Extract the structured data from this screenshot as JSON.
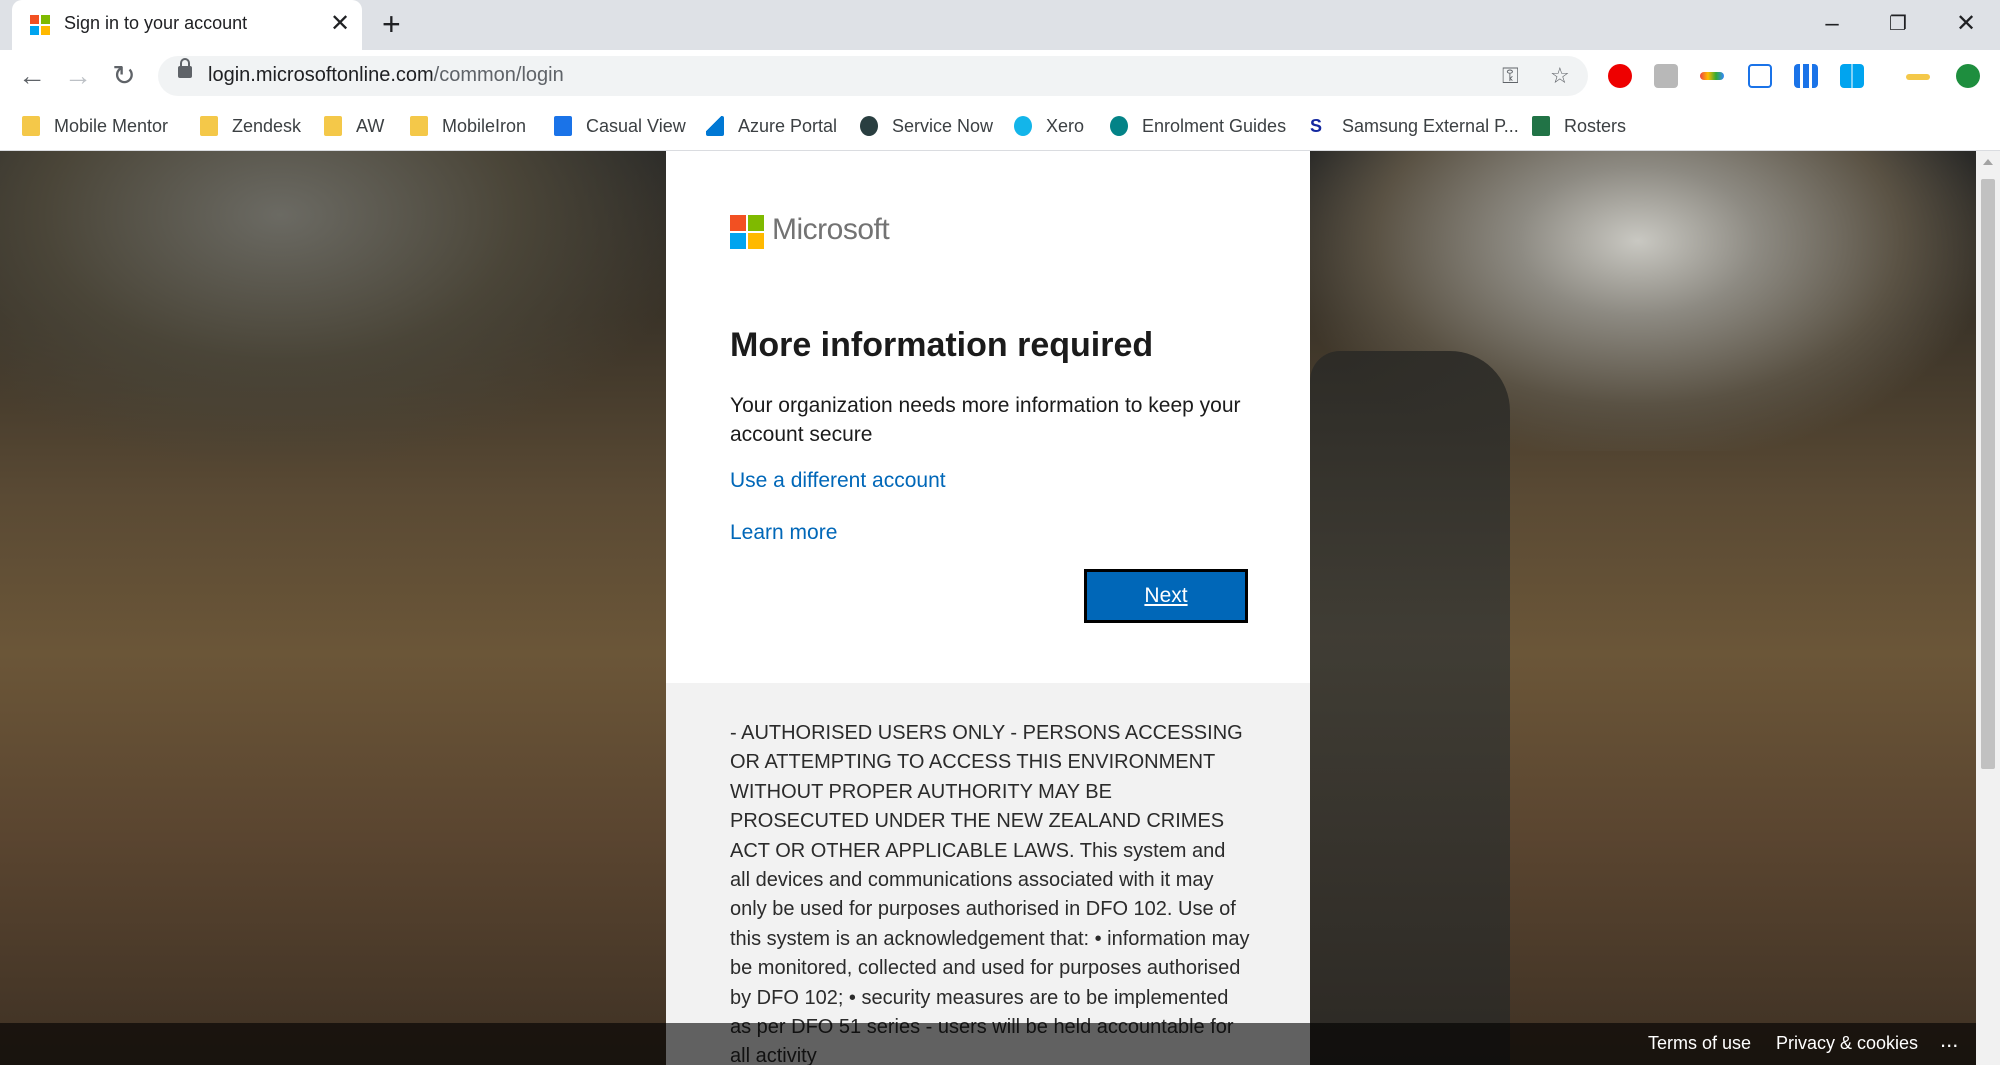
{
  "browser": {
    "tab_title": "Sign in to your account",
    "url_host": "login.microsoftonline.com",
    "url_path": "/common/login",
    "bookmarks": [
      {
        "label": "Mobile Mentor",
        "icon": "folder-icon"
      },
      {
        "label": "Zendesk",
        "icon": "folder-icon"
      },
      {
        "label": "AW",
        "icon": "folder-icon"
      },
      {
        "label": "MobileIron",
        "icon": "folder-icon"
      },
      {
        "label": "Casual View",
        "icon": "casual-view-icon"
      },
      {
        "label": "Azure Portal",
        "icon": "azure-icon"
      },
      {
        "label": "Service Now",
        "icon": "servicenow-icon"
      },
      {
        "label": "Xero",
        "icon": "xero-icon"
      },
      {
        "label": "Enrolment Guides",
        "icon": "sharepoint-icon"
      },
      {
        "label": "Samsung External P...",
        "icon": "samsung-s-icon"
      },
      {
        "label": "Rosters",
        "icon": "excel-icon"
      }
    ]
  },
  "card": {
    "logo_text": "Microsoft",
    "title": "More information required",
    "description": "Your organization needs more information to keep your account secure",
    "use_different_account": "Use a different account",
    "learn_more": "Learn more",
    "next_label": "Next"
  },
  "notice": {
    "text": "- AUTHORISED USERS ONLY - PERSONS ACCESSING OR ATTEMPTING TO ACCESS THIS ENVIRONMENT WITHOUT PROPER AUTHORITY MAY BE PROSECUTED UNDER THE NEW ZEALAND CRIMES ACT OR OTHER APPLICABLE LAWS. This system and all devices and communications associated with it may only be used for purposes authorised in DFO 102. Use of this system is an acknowledgement that: • information may be monitored, collected and used for purposes authorised by DFO 102; • security measures are to be implemented as per DFO 51 series - users will be held accountable for all activity"
  },
  "footer": {
    "terms": "Terms of use",
    "privacy": "Privacy & cookies",
    "more": "..."
  },
  "colors": {
    "link": "#0067b8",
    "button": "#0067b8",
    "ms_red": "#f25022",
    "ms_green": "#7fba00",
    "ms_blue": "#00a4ef",
    "ms_yellow": "#ffb900"
  }
}
